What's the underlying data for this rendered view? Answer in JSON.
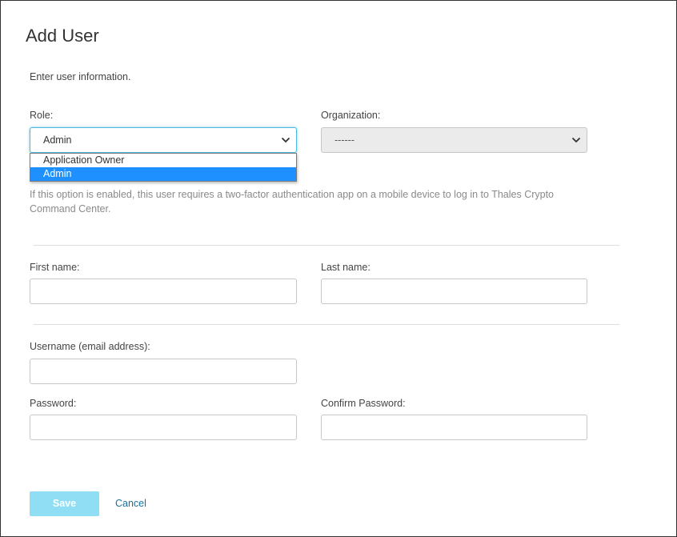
{
  "dialog": {
    "title": "Add User",
    "intro": "Enter user information."
  },
  "role": {
    "label": "Role:",
    "selected": "Admin",
    "options": [
      "Application Owner",
      "Admin"
    ],
    "highlighted_option": "Admin"
  },
  "organization": {
    "label": "Organization:",
    "selected": "------"
  },
  "two_factor": {
    "help_text": "If this option is enabled, this user requires a two-factor authentication app on a mobile device to log in to Thales Crypto Command Center."
  },
  "name": {
    "first_label": "First name:",
    "first_value": "",
    "last_label": "Last name:",
    "last_value": ""
  },
  "account": {
    "username_label": "Username (email address):",
    "username_value": "",
    "password_label": "Password:",
    "password_value": "",
    "confirm_label": "Confirm Password:",
    "confirm_value": ""
  },
  "actions": {
    "save_label": "Save",
    "cancel_label": "Cancel"
  },
  "colors": {
    "accent": "#1e90ff",
    "save_disabled": "#8fdef4",
    "link": "#1d6f99",
    "focus_border": "#4fb8de"
  },
  "icons": {
    "select_caret": "chevron-down-icon"
  }
}
